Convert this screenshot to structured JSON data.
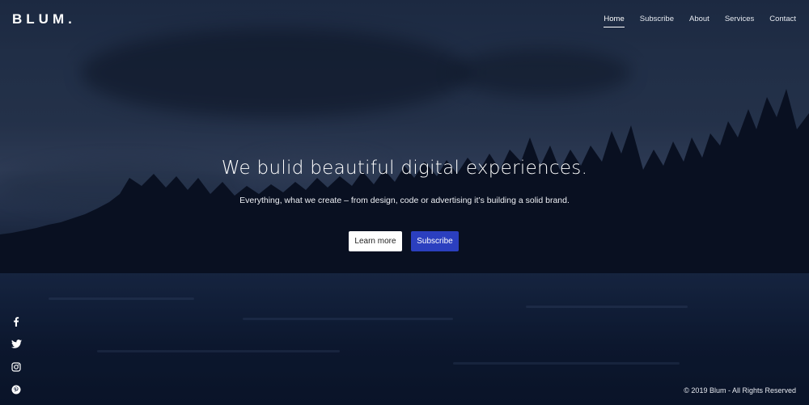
{
  "brand": {
    "logo": "BLUM."
  },
  "nav": {
    "items": [
      {
        "label": "Home",
        "active": true
      },
      {
        "label": "Subscribe",
        "active": false
      },
      {
        "label": "About",
        "active": false
      },
      {
        "label": "Services",
        "active": false
      },
      {
        "label": "Contact",
        "active": false
      }
    ]
  },
  "hero": {
    "title": "We bulid beautiful digital experiences.",
    "subtitle": "Everything, what we create – from design, code or advertising it’s building a solid brand.",
    "primary_button": "Learn more",
    "secondary_button": "Subscribe"
  },
  "social": {
    "icons": [
      "facebook-icon",
      "twitter-icon",
      "instagram-icon",
      "pinterest-icon"
    ]
  },
  "footer": {
    "copyright": "© 2019 Blum - All Rights Reserved"
  },
  "colors": {
    "accent": "#2b3fbf",
    "overlay": "#0b1226"
  }
}
